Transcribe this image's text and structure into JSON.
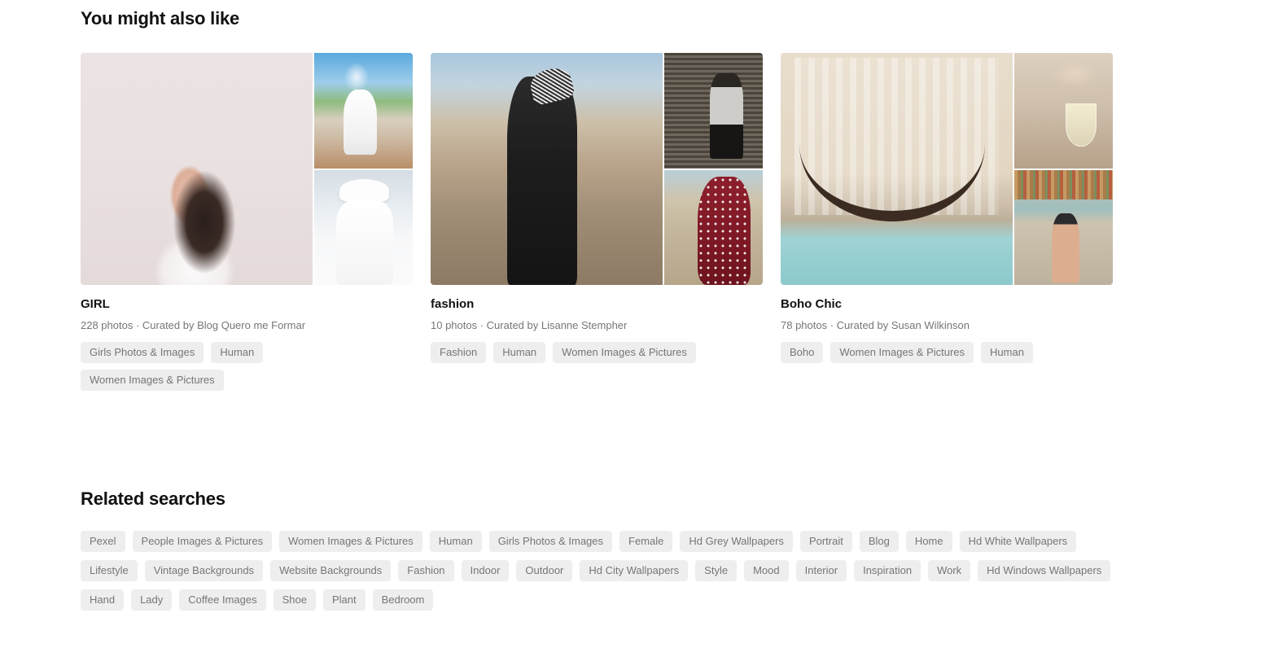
{
  "suggestions": {
    "heading": "You might also like",
    "collections": [
      {
        "title": "GIRL",
        "meta": "228 photos · Curated by Blog Quero me Formar",
        "photo_count": "228 photos",
        "curator": "Curated by Blog Quero me Formar",
        "tags": [
          "Girls Photos & Images",
          "Human",
          "Women Images & Pictures"
        ],
        "images": [
          "girl-portrait-main",
          "girl-terrace-thumb",
          "girl-white-hat-thumb"
        ]
      },
      {
        "title": "fashion",
        "meta": "10 photos · Curated by Lisanne Stempher",
        "photo_count": "10 photos",
        "curator": "Curated by Lisanne Stempher",
        "tags": [
          "Fashion",
          "Human",
          "Women Images & Pictures"
        ],
        "images": [
          "fashion-street-main",
          "fashion-sweater-thumb",
          "fashion-red-dress-thumb"
        ]
      },
      {
        "title": "Boho Chic",
        "meta": "78 photos · Curated by Susan Wilkinson",
        "photo_count": "78 photos",
        "curator": "Curated by Susan Wilkinson",
        "tags": [
          "Boho",
          "Women Images & Pictures",
          "Human"
        ],
        "images": [
          "boho-hammock-main",
          "boho-wine-thumb",
          "boho-beach-dress-thumb"
        ]
      }
    ]
  },
  "related": {
    "heading": "Related searches",
    "tags": [
      "Pexel",
      "People Images & Pictures",
      "Women Images & Pictures",
      "Human",
      "Girls Photos & Images",
      "Female",
      "Hd Grey Wallpapers",
      "Portrait",
      "Blog",
      "Home",
      "Hd White Wallpapers",
      "Lifestyle",
      "Vintage Backgrounds",
      "Website Backgrounds",
      "Fashion",
      "Indoor",
      "Outdoor",
      "Hd City Wallpapers",
      "Style",
      "Mood",
      "Interior",
      "Inspiration",
      "Work",
      "Hd Windows Wallpapers",
      "Hand",
      "Lady",
      "Coffee Images",
      "Shoe",
      "Plant",
      "Bedroom"
    ]
  },
  "theme": {
    "background": "#ffffff",
    "text_primary": "#111111",
    "text_secondary": "#767676",
    "chip_background": "#eeeeee"
  }
}
